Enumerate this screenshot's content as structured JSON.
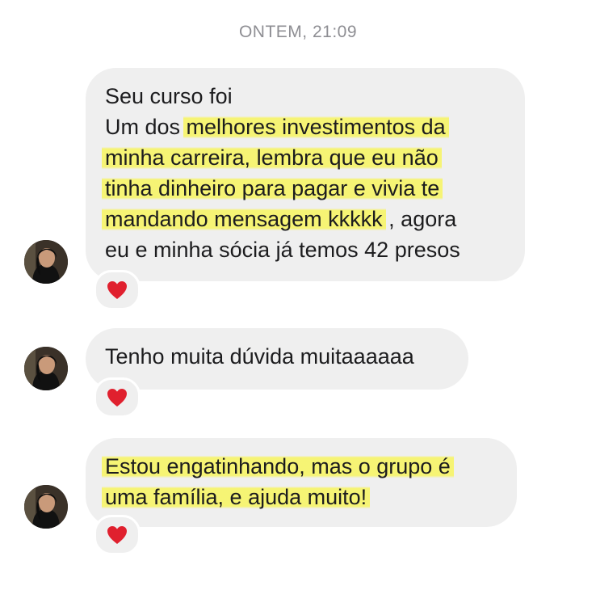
{
  "timestamp": "ONTEM, 21:09",
  "messages": [
    {
      "lines": [
        {
          "plain": "Seu curso foi",
          "highlight": ""
        },
        {
          "plain": "Um dos ",
          "highlight": "melhores investimentos da"
        },
        {
          "plain": "",
          "highlight": "minha carreira, lembra que eu não"
        },
        {
          "plain": "",
          "highlight": "tinha dinheiro para pagar e vivia te"
        },
        {
          "plain": "",
          "highlight": "mandando mensagem kkkkk",
          "after": " , agora"
        },
        {
          "plain": "eu e minha sócia já temos 42 presos",
          "highlight": ""
        }
      ],
      "reaction": "red-heart-icon"
    },
    {
      "lines": [
        {
          "plain": "Tenho muita dúvida muitaaaaaa",
          "highlight": ""
        }
      ],
      "reaction": "red-heart-icon"
    },
    {
      "lines": [
        {
          "plain": "",
          "highlight": "Estou engatinhando, mas o grupo é"
        },
        {
          "plain": "",
          "highlight": "uma família, e ajuda muito!"
        }
      ],
      "reaction": "red-heart-icon"
    }
  ],
  "colors": {
    "bubble": "#efefef",
    "highlight": "#f6f46e",
    "heart": "#e0202e",
    "timestamp": "#8e8e93"
  }
}
